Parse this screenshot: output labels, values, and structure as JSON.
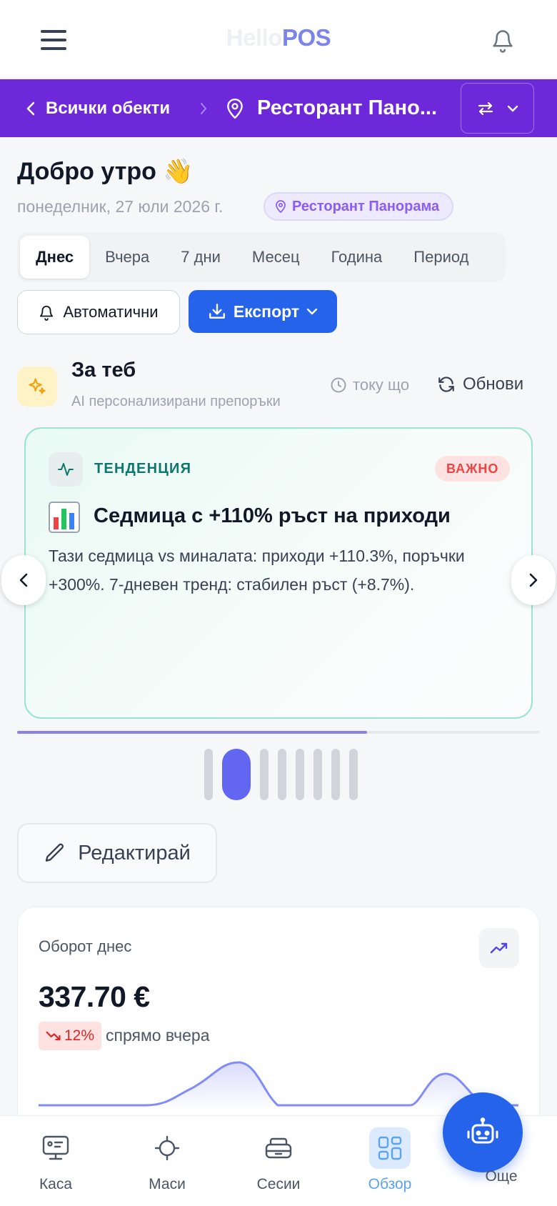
{
  "header": {
    "logo_part1": "Hello",
    "logo_part2": "POS"
  },
  "location_bar": {
    "back_label": "Всички обекти",
    "location_name": "Ресторант Пано..."
  },
  "greeting": {
    "title": "Добро утро 👋",
    "date": "понеделник, 27 юли 2026 г.",
    "location_badge": "Ресторант Панорама"
  },
  "tabs": [
    "Днес",
    "Вчера",
    "7 дни",
    "Месец",
    "Година",
    "Период"
  ],
  "active_tab": "Днес",
  "actions": {
    "auto_label": "Автоматични",
    "export_label": "Експорт"
  },
  "for_you": {
    "title": "За теб",
    "subtitle": "AI персонализирани препоръки",
    "updated": "току що",
    "refresh_label": "Обнови"
  },
  "insight": {
    "type": "ТЕНДЕНЦИЯ",
    "badge": "ВАЖНО",
    "emoji": "📊",
    "title": "Седмица с +110% ръст на приходи",
    "body": "Тази седмица vs миналата: приходи +110.3%, поръчки +300%. 7-дневен тренд: стабилен ръст (+8.7%)."
  },
  "carousel": {
    "progress": 0.67,
    "dot_count": 8,
    "active_dot": 1
  },
  "edit_label": "Редактирай",
  "turnover": {
    "label": "Оборот днес",
    "value": "337.70 €",
    "delta": "12%",
    "comparison": "спрямо вчера",
    "trend": "down"
  },
  "bottom_nav": [
    {
      "label": "Каса",
      "icon": "pos-terminal-icon"
    },
    {
      "label": "Маси",
      "icon": "table-icon"
    },
    {
      "label": "Сесии",
      "icon": "sessions-icon"
    },
    {
      "label": "Обзор",
      "icon": "dashboard-icon",
      "active": true
    },
    {
      "label": "Още",
      "icon": "robot-icon"
    }
  ],
  "colors": {
    "brand": "#6d28d9",
    "primary": "#2563eb",
    "accent": "#6366f1",
    "danger": "#dc2626",
    "trend": "#0f766e"
  }
}
